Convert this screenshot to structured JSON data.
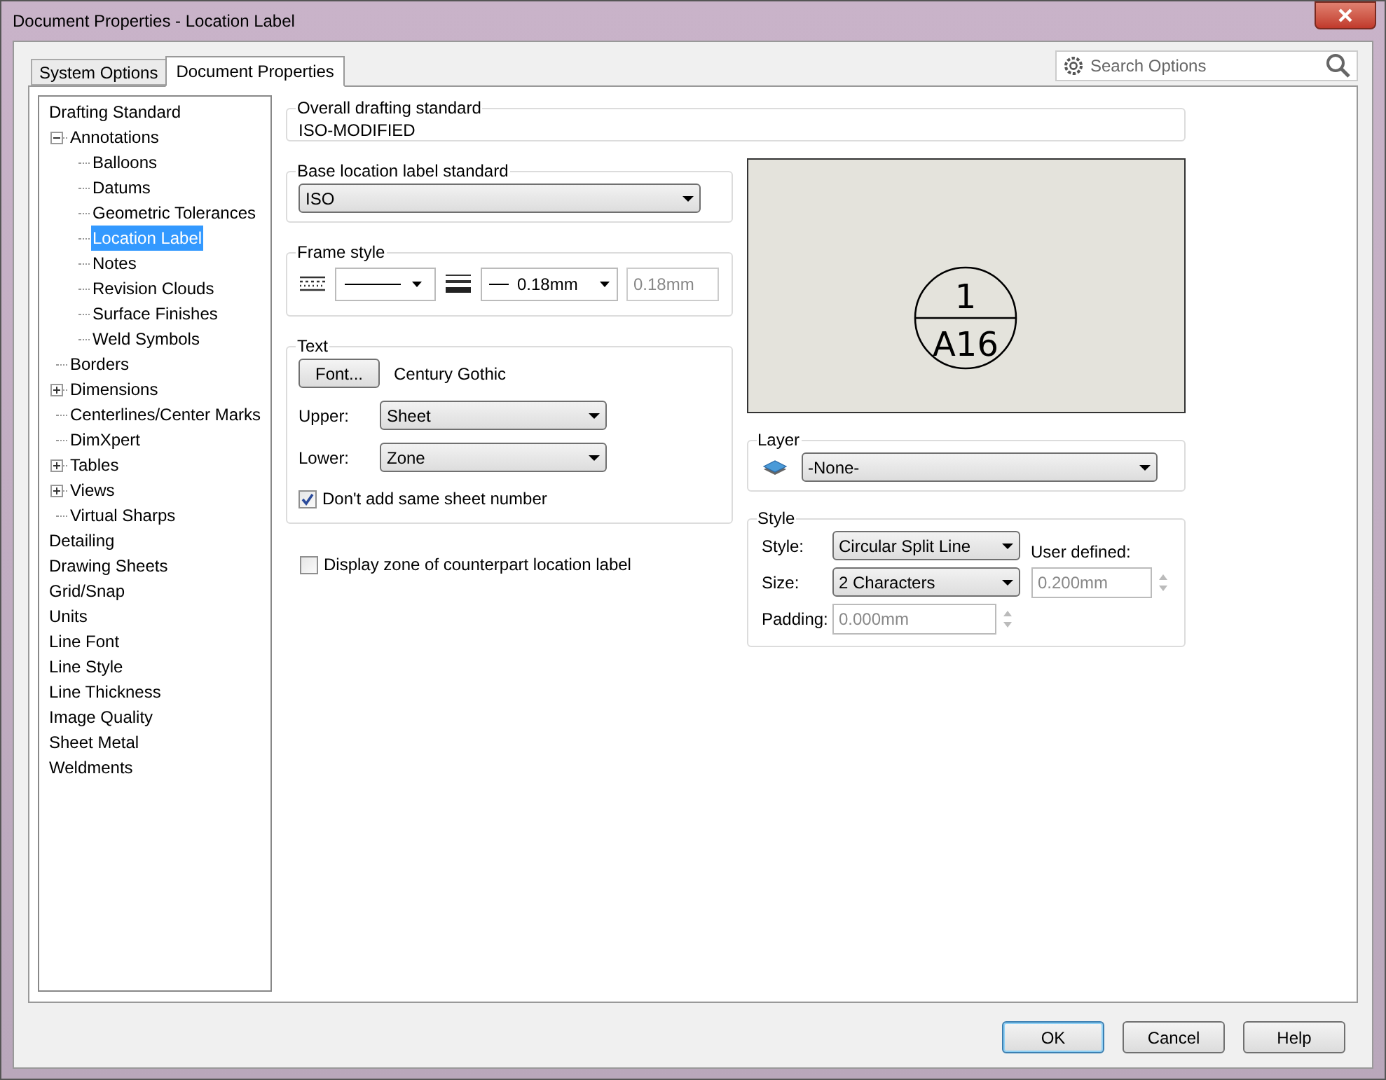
{
  "window": {
    "title": "Document Properties - Location Label"
  },
  "tabs": [
    {
      "label": "System Options",
      "selected": false
    },
    {
      "label": "Document Properties",
      "selected": true
    }
  ],
  "search": {
    "placeholder": "Search Options"
  },
  "tree": [
    {
      "label": "Drafting Standard",
      "selected": false,
      "children": [
        {
          "label": "Annotations",
          "expanded": true,
          "selected": false,
          "children": [
            {
              "label": "Balloons",
              "selected": false
            },
            {
              "label": "Datums",
              "selected": false
            },
            {
              "label": "Geometric Tolerances",
              "selected": false
            },
            {
              "label": "Location Label",
              "selected": true
            },
            {
              "label": "Notes",
              "selected": false
            },
            {
              "label": "Revision Clouds",
              "selected": false
            },
            {
              "label": "Surface Finishes",
              "selected": false
            },
            {
              "label": "Weld Symbols",
              "selected": false
            }
          ]
        },
        {
          "label": "Borders",
          "selected": false
        },
        {
          "label": "Dimensions",
          "expanded": false,
          "selected": false
        },
        {
          "label": "Centerlines/Center Marks",
          "selected": false
        },
        {
          "label": "DimXpert",
          "selected": false
        },
        {
          "label": "Tables",
          "expanded": false,
          "selected": false
        },
        {
          "label": "Views",
          "expanded": false,
          "selected": false
        },
        {
          "label": "Virtual Sharps",
          "selected": false
        }
      ]
    },
    {
      "label": "Detailing",
      "selected": false
    },
    {
      "label": "Drawing Sheets",
      "selected": false
    },
    {
      "label": "Grid/Snap",
      "selected": false
    },
    {
      "label": "Units",
      "selected": false
    },
    {
      "label": "Line Font",
      "selected": false
    },
    {
      "label": "Line Style",
      "selected": false
    },
    {
      "label": "Line Thickness",
      "selected": false
    },
    {
      "label": "Image Quality",
      "selected": false
    },
    {
      "label": "Sheet Metal",
      "selected": false
    },
    {
      "label": "Weldments",
      "selected": false
    }
  ],
  "overall_standard": {
    "label": "Overall drafting standard",
    "value": "ISO-MODIFIED"
  },
  "base_standard": {
    "label": "Base location label standard",
    "value": "ISO"
  },
  "frame_style": {
    "label": "Frame style",
    "thickness": "0.18mm",
    "custom_thickness": {
      "value": "0.18mm",
      "disabled": true
    }
  },
  "text": {
    "label": "Text",
    "font_button": "Font...",
    "font_name": "Century Gothic",
    "upper": {
      "label": "Upper:",
      "value": "Sheet"
    },
    "lower": {
      "label": "Lower:",
      "value": "Zone"
    },
    "same_sheet": {
      "label": "Don't add same sheet number",
      "checked": true
    }
  },
  "display_zone": {
    "label": "Display zone of counterpart location label",
    "checked": false
  },
  "preview": {
    "upper": "1",
    "lower": "A16"
  },
  "layer": {
    "label": "Layer",
    "value": "-None-"
  },
  "style": {
    "label": "Style",
    "style": {
      "label": "Style:",
      "value": "Circular Split Line"
    },
    "size": {
      "label": "Size:",
      "value": "2 Characters"
    },
    "user_defined": {
      "label": "User defined:",
      "value": "0.200mm",
      "disabled": true
    },
    "padding": {
      "label": "Padding:",
      "value": "0.000mm",
      "disabled": true
    }
  },
  "buttons": [
    {
      "label": "OK",
      "kind": "default"
    },
    {
      "label": "Cancel",
      "kind": "normal"
    },
    {
      "label": "Help",
      "kind": "normal"
    }
  ]
}
